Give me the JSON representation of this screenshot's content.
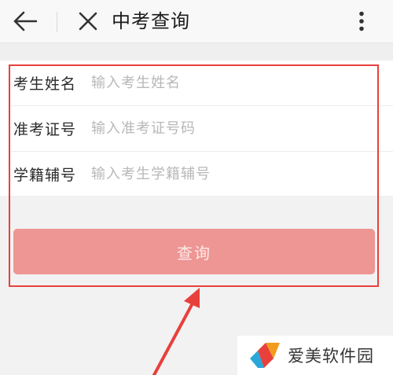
{
  "header": {
    "title": "中考查询",
    "back_icon": "back-arrow-icon",
    "close_icon": "close-icon",
    "more_icon": "more-vertical-icon"
  },
  "form": {
    "fields": [
      {
        "label": "考生姓名",
        "placeholder": "输入考生姓名",
        "value": ""
      },
      {
        "label": "准考证号",
        "placeholder": "输入准考证号码",
        "value": ""
      },
      {
        "label": "学籍辅号",
        "placeholder": "输入考生学籍辅号",
        "value": ""
      }
    ],
    "submit_label": "查询"
  },
  "annotation": {
    "highlight_color": "#e8403d"
  },
  "watermark": {
    "text": "爱美软件园"
  },
  "colors": {
    "button": "#ee9694",
    "button_text": "#fde9e8",
    "background": "#f2f2f2"
  }
}
